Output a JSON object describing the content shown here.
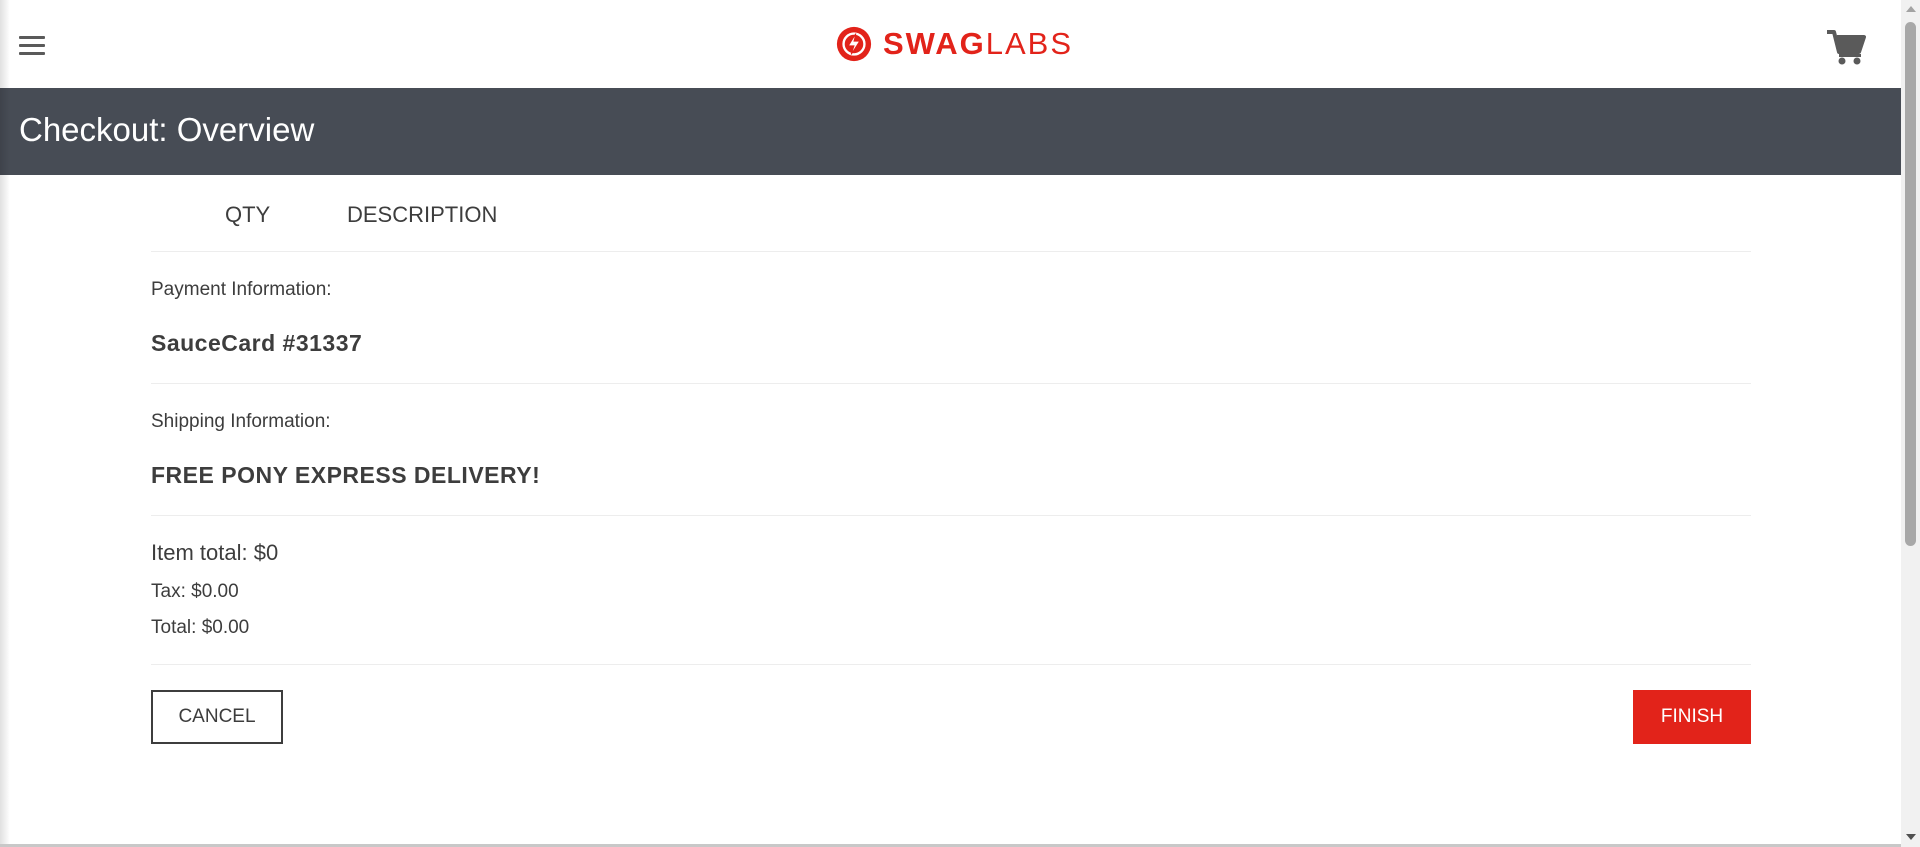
{
  "header": {
    "menu_icon": "hamburger-menu-icon",
    "logo": {
      "icon": "lightning-bolt-circle-icon",
      "brand_strong": "SWAG",
      "brand_light": "LABS",
      "color": "#e2231a"
    },
    "cart_icon": "shopping-cart-icon"
  },
  "secondary_header": {
    "title": "Checkout: Overview",
    "background_color": "#474c55"
  },
  "cart_list": {
    "qty_label": "QTY",
    "description_label": "DESCRIPTION"
  },
  "summary": {
    "payment_label": "Payment Information:",
    "payment_value": "SauceCard #31337",
    "shipping_label": "Shipping Information:",
    "shipping_value": "FREE PONY EXPRESS DELIVERY!",
    "item_total": "Item total: $0",
    "tax": "Tax: $0.00",
    "total": "Total: $0.00"
  },
  "actions": {
    "cancel_label": "CANCEL",
    "finish_label": "FINISH",
    "finish_color": "#e2231a"
  }
}
